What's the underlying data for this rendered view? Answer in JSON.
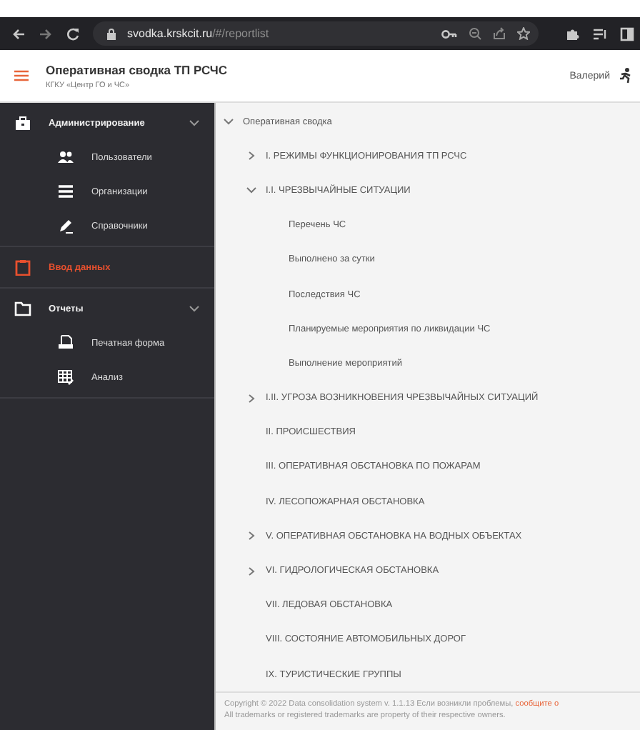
{
  "browser": {
    "url_host": "svodka.krskcit.ru",
    "url_path": "/#/reportlist"
  },
  "header": {
    "title": "Оперативная сводка ТП РСЧС",
    "subtitle": "КГКУ «Центр ГО и ЧС»",
    "user": "Валерий"
  },
  "sidebar": {
    "items": [
      {
        "label": "Администрирование",
        "selected": false,
        "expanded": true,
        "children": [
          {
            "label": "Пользователи",
            "selected": false
          },
          {
            "label": "Организации",
            "selected": false
          },
          {
            "label": "Справочники",
            "selected": false
          }
        ]
      },
      {
        "label": "Ввод данных",
        "selected": true
      },
      {
        "label": "Отчеты",
        "selected": false,
        "expanded": true,
        "children": [
          {
            "label": "Печатная форма",
            "selected": false
          },
          {
            "label": "Анализ",
            "selected": false
          }
        ]
      }
    ]
  },
  "tree": [
    {
      "label": "Оперативная сводка",
      "kind": "group",
      "expanded": true,
      "children": [
        {
          "label": "I. РЕЖИМЫ ФУНКЦИОНИРОВАНИЯ ТП РСЧС",
          "kind": "group",
          "expanded": false
        },
        {
          "label": "I.I. ЧРЕЗВЫЧАЙНЫЕ СИТУАЦИИ",
          "kind": "group",
          "expanded": true,
          "children": [
            {
              "label": "Перечень ЧС",
              "kind": "leaf"
            },
            {
              "label": "Выполнено за сутки",
              "kind": "leaf"
            },
            {
              "label": "Последствия ЧС",
              "kind": "leaf"
            },
            {
              "label": "Планируемые мероприятия по ликвидации ЧС",
              "kind": "leaf"
            },
            {
              "label": "Выполнение мероприятий",
              "kind": "leaf"
            }
          ]
        },
        {
          "label": "I.II. УГРОЗА ВОЗНИКНОВЕНИЯ ЧРЕЗВЫЧАЙНЫХ СИТУАЦИЙ",
          "kind": "group",
          "expanded": false
        },
        {
          "label": "II. ПРОИСШЕСТВИЯ",
          "kind": "leaf"
        },
        {
          "label": "III. ОПЕРАТИВНАЯ ОБСТАНОВКА ПО ПОЖАРАМ",
          "kind": "leaf"
        },
        {
          "label": "IV. ЛЕСОПОЖАРНАЯ ОБСТАНОВКА",
          "kind": "leaf"
        },
        {
          "label": "V. ОПЕРАТИВНАЯ ОБСТАНОВКА НА ВОДНЫХ ОБЪЕКТАХ",
          "kind": "group",
          "expanded": false
        },
        {
          "label": "VI. ГИДРОЛОГИЧЕСКАЯ ОБСТАНОВКА",
          "kind": "group",
          "expanded": false
        },
        {
          "label": "VII. ЛЕДОВАЯ ОБСТАНОВКА",
          "kind": "leaf"
        },
        {
          "label": "VIII. СОСТОЯНИЕ АВТОМОБИЛЬНЫХ ДОРОГ",
          "kind": "leaf"
        },
        {
          "label": "IX. ТУРИСТИЧЕСКИЕ ГРУППЫ",
          "kind": "leaf"
        }
      ]
    }
  ],
  "footer": {
    "copyright": "Copyright © 2022 Data consolidation system v. 1.1.13 Если возникли проблемы,",
    "link": "сообщите о",
    "trademarks": "All trademarks or registered trademarks are property of their respective owners."
  }
}
